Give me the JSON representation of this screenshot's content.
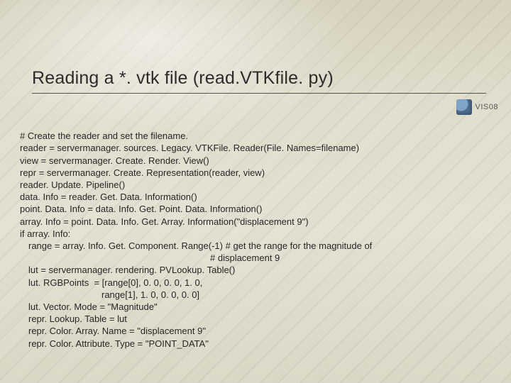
{
  "title": "Reading a *. vtk file (read.VTKfile. py)",
  "logo_text": "VIS08",
  "code": {
    "l1": "# Create the reader and set the filename.",
    "l2": "reader = servermanager. sources. Legacy. VTKFile. Reader(File. Names=filename)",
    "l3": "view = servermanager. Create. Render. View()",
    "l4": "repr = servermanager. Create. Representation(reader, view)",
    "l5": "reader. Update. Pipeline()",
    "l6": "data. Info = reader. Get. Data. Information()",
    "l7": "point. Data. Info = data. Info. Get. Point. Data. Information()",
    "l8": "array. Info = point. Data. Info. Get. Array. Information(\"displacement 9\")",
    "l9": "if array. Info:",
    "l10": "range = array. Info. Get. Component. Range(-1) # get the range for the magnitude of",
    "l11": "# displacement 9",
    "l12": "lut = servermanager. rendering. PVLookup. Table()",
    "l13": "lut. RGBPoints  = [range[0], 0. 0, 0. 0, 1. 0,",
    "l14": "range[1], 1. 0, 0. 0, 0. 0]",
    "l15": "lut. Vector. Mode = \"Magnitude\"",
    "l16": "repr. Lookup. Table = lut",
    "l17": "repr. Color. Array. Name = \"displacement 9\"",
    "l18": "repr. Color. Attribute. Type = \"POINT_DATA\""
  }
}
